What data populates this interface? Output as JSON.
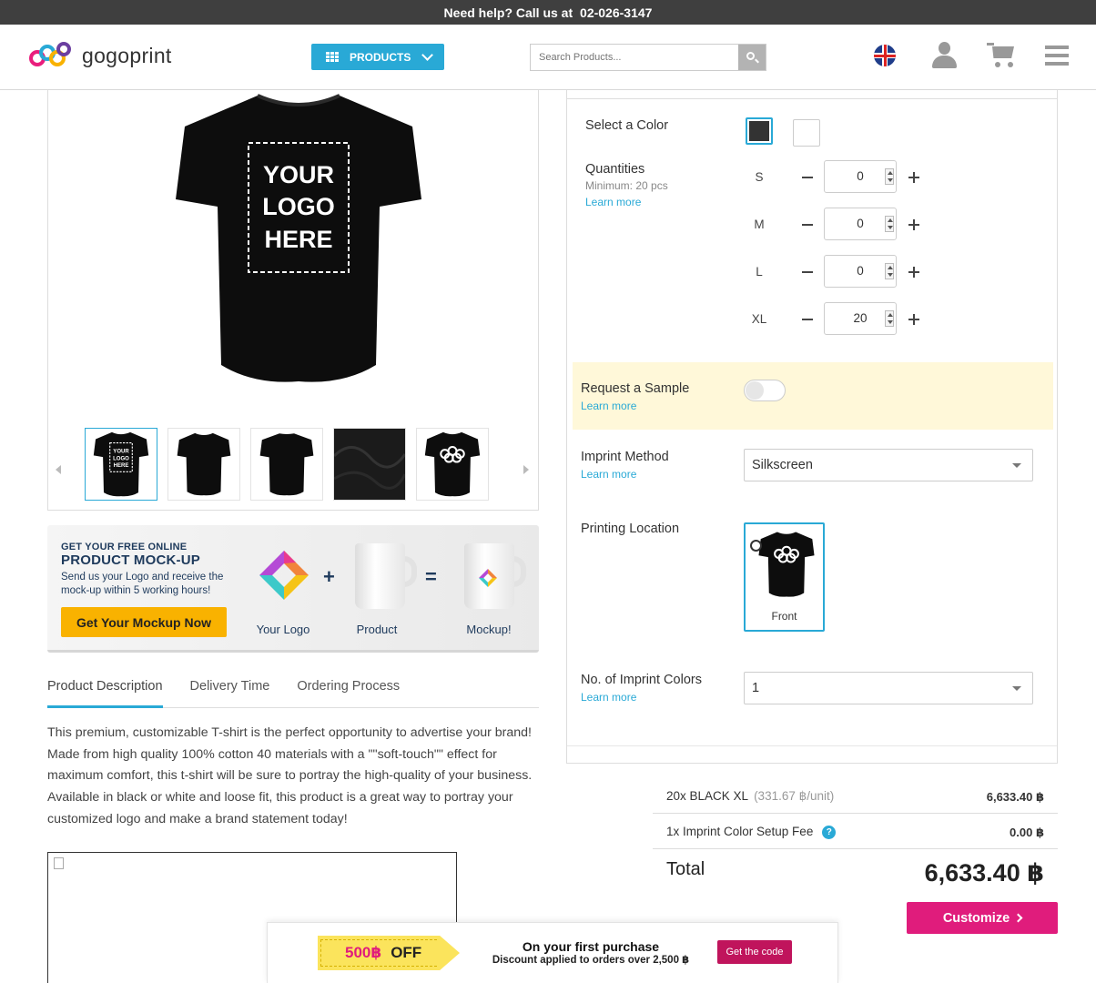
{
  "topbar": {
    "help_text": "Need help? Call us at",
    "phone": "02-026-3147"
  },
  "header": {
    "logo_text": "gogoprint",
    "products_label": "PRODUCTS",
    "search_placeholder": "Search Products...",
    "icons": [
      "grid-icon",
      "chevron-down-icon",
      "search-icon",
      "uk-flag-icon",
      "user-icon",
      "cart-icon",
      "menu-icon"
    ]
  },
  "gallery": {
    "main_overlay": [
      "YOUR",
      "LOGO",
      "HERE"
    ],
    "thumb_overlay": [
      "YOUR",
      "LOGO",
      "HERE"
    ]
  },
  "mockup_banner": {
    "small_title": "GET YOUR FREE ONLINE",
    "big_title": "PRODUCT MOCK-UP",
    "description": "Send us your Logo and receive the mock-up within 5 working hours!",
    "button": "Get Your Mockup Now",
    "plus": "+",
    "equals": "=",
    "captions": [
      "Your Logo",
      "Product",
      "Mockup!"
    ]
  },
  "tabs": [
    {
      "label": "Product Description",
      "active": true
    },
    {
      "label": "Delivery Time",
      "active": false
    },
    {
      "label": "Ordering Process",
      "active": false
    }
  ],
  "description": "This premium, customizable T-shirt is the perfect opportunity to advertise your brand! Made from high quality 100% cotton 40 materials with a \"\"soft-touch\"\" effect for maximum comfort, this t-shirt will be sure to portray the high-quality of your business. Available in black or white and loose fit, this product is a great way to portray your customized logo and make a brand statement today!",
  "options": {
    "color_label": "Select a Color",
    "colors": [
      "#333333",
      "#ffffff"
    ],
    "quantities_label": "Quantities",
    "quantities_min": "Minimum: 20 pcs",
    "learn_more": "Learn more",
    "sizes": [
      {
        "size": "S",
        "qty": "0"
      },
      {
        "size": "M",
        "qty": "0"
      },
      {
        "size": "L",
        "qty": "0"
      },
      {
        "size": "XL",
        "qty": "20"
      }
    ],
    "sample_label": "Request a Sample",
    "imprint_label": "Imprint Method",
    "imprint_value": "Silkscreen",
    "location_label": "Printing Location",
    "location_value": "Front",
    "colors_count_label": "No. of Imprint Colors",
    "colors_count_value": "1"
  },
  "summary": {
    "line1_label": "20x BLACK XL",
    "line1_unit": "(331.67 ฿/unit)",
    "line1_price": "6,633.40 ฿",
    "line2_label": "1x Imprint Color Setup Fee",
    "line2_help": "?",
    "line2_price": "0.00 ฿",
    "total_label": "Total",
    "total_value": "6,633.40 ฿",
    "customize": "Customize"
  },
  "promo": {
    "amount": "500฿",
    "off": "OFF",
    "line1": "On your first purchase",
    "line2": "Discount applied to orders over 2,500 ฿",
    "button": "Get the code"
  }
}
